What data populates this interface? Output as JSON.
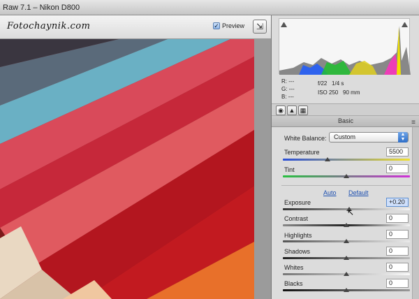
{
  "window": {
    "title": "Raw 7.1  –  Nikon D800"
  },
  "toolbar": {
    "watermark": "Fotochaynik.com",
    "preview_label": "Preview",
    "preview_checked": true,
    "icons": {
      "fullscreen": "fullscreen-toggle-icon"
    }
  },
  "readout": {
    "r_label": "R:",
    "r_value": "---",
    "g_label": "G:",
    "g_value": "---",
    "b_label": "B:",
    "b_value": "---",
    "aperture": "f/22",
    "shutter": "1/4 s",
    "iso": "ISO 250",
    "focal": "90 mm"
  },
  "panel_tabs": {
    "icons": [
      "basic-tab-icon",
      "tone-curve-tab-icon",
      "detail-tab-icon"
    ]
  },
  "section": {
    "title": "Basic"
  },
  "white_balance": {
    "label": "White Balance:",
    "value": "Custom"
  },
  "links": {
    "auto": "Auto",
    "default": "Default"
  },
  "sliders": {
    "temperature": {
      "label": "Temperature",
      "value": "5500",
      "level": 0.35
    },
    "tint": {
      "label": "Tint",
      "value": "0",
      "level": 0.5
    },
    "exposure": {
      "label": "Exposure",
      "value": "+0.20",
      "level": 0.52
    },
    "contrast": {
      "label": "Contrast",
      "value": "0",
      "level": 0.5
    },
    "highlights": {
      "label": "Highlights",
      "value": "0",
      "level": 0.5
    },
    "shadows": {
      "label": "Shadows",
      "value": "0",
      "level": 0.5
    },
    "whites": {
      "label": "Whites",
      "value": "0",
      "level": 0.5
    },
    "blacks": {
      "label": "Blacks",
      "value": "0",
      "level": 0.5
    }
  },
  "colors": {
    "accent": "#2f6fc8",
    "link": "#1c4fb0",
    "value_highlight": "#cfe0fb"
  }
}
